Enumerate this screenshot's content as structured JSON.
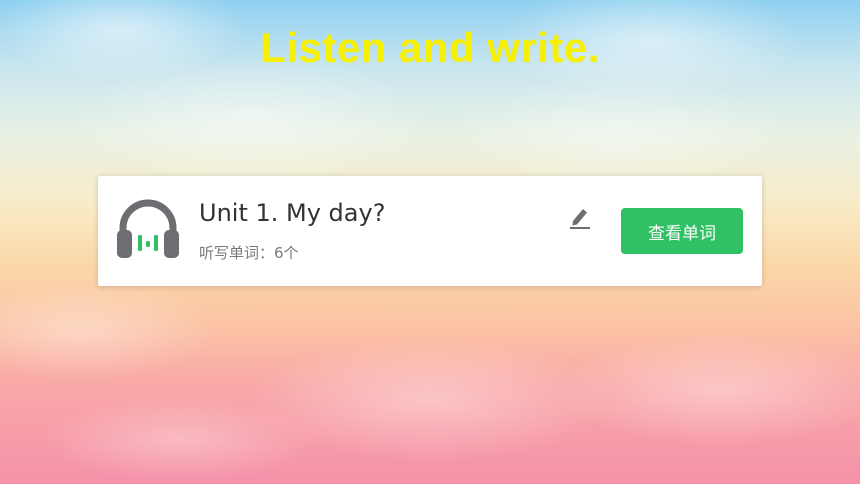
{
  "page": {
    "title": "Listen and write."
  },
  "card": {
    "icon": "headphones-icon",
    "unit_title": "Unit 1. My day?",
    "subtitle": "听写单词：6个",
    "edit_icon": "pencil-icon",
    "view_button_label": "查看单词"
  },
  "colors": {
    "title": "#f7f000",
    "button": "#2fc163",
    "headphone_body": "#6d6e72",
    "headphone_accent": "#2fc163"
  }
}
